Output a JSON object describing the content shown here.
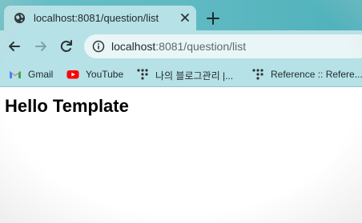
{
  "browser": {
    "tab": {
      "title": "localhost:8081/question/list"
    },
    "address_bar": {
      "host": "localhost",
      "rest": ":8081/question/list"
    },
    "bookmarks": [
      {
        "label": "Gmail",
        "icon": "gmail-icon"
      },
      {
        "label": "YouTube",
        "icon": "youtube-icon"
      },
      {
        "label": "나의 블로그관리 |...",
        "icon": "tistory-icon"
      },
      {
        "label": "Reference :: Refere...",
        "icon": "tistory-icon"
      }
    ]
  },
  "page": {
    "heading": "Hello Template"
  },
  "colors": {
    "tabstrip": "#5fb9c2",
    "toolbar": "#b6e1e6",
    "omnibox": "#e9f5f6",
    "youtube_red": "#ff0000"
  }
}
